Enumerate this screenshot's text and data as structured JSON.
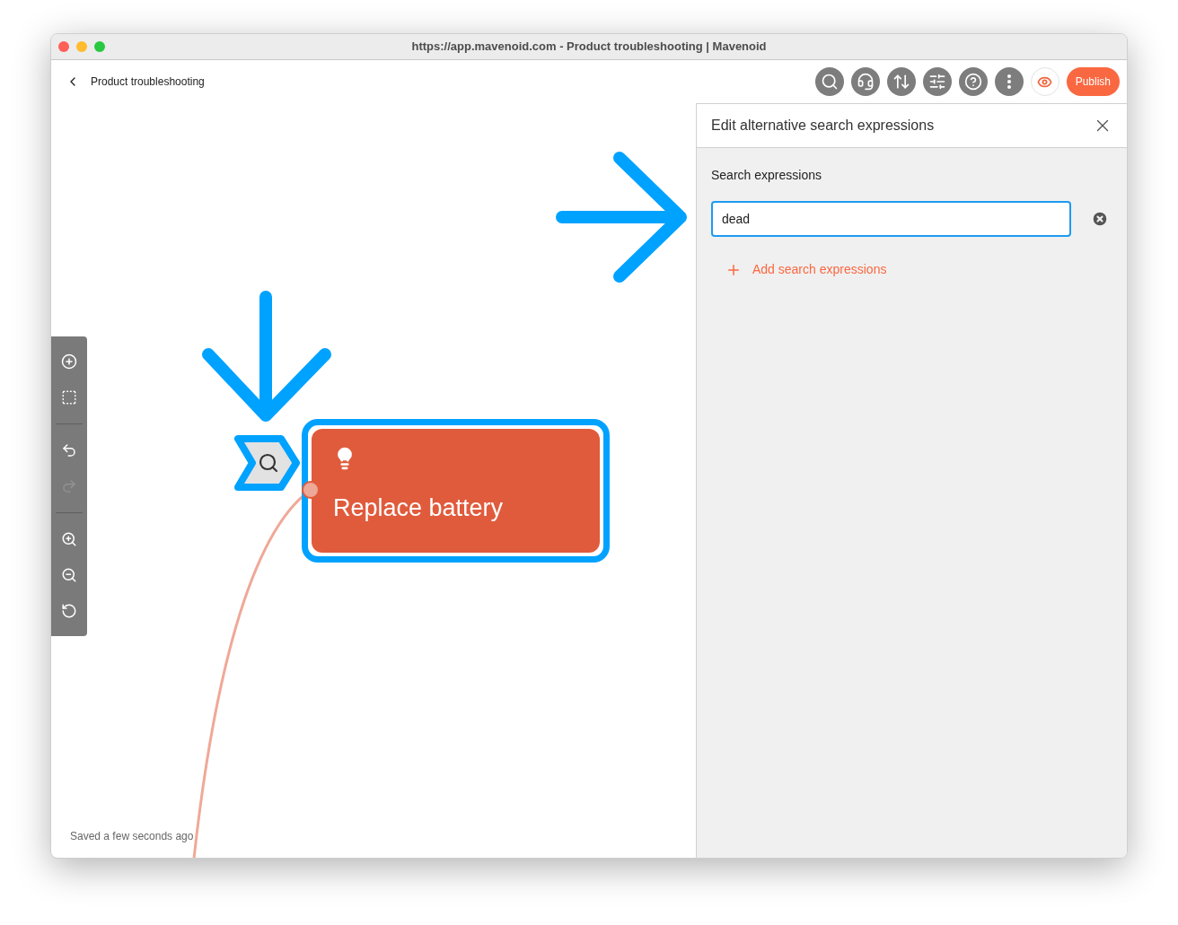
{
  "window": {
    "title": "https://app.mavenoid.com - Product troubleshooting | Mavenoid"
  },
  "header": {
    "title": "Product troubleshooting",
    "publish": "Publish"
  },
  "canvas_tools": [
    {
      "kind": "add",
      "disabled": false
    },
    {
      "kind": "select",
      "disabled": false
    },
    {
      "kind": "divider"
    },
    {
      "kind": "undo",
      "disabled": false
    },
    {
      "kind": "redo",
      "disabled": true
    },
    {
      "kind": "divider"
    },
    {
      "kind": "zoom-in",
      "disabled": false
    },
    {
      "kind": "zoom-out",
      "disabled": false
    },
    {
      "kind": "zoom-reset",
      "disabled": false
    }
  ],
  "search_tag": {
    "selected": true
  },
  "node": {
    "title": "Replace battery",
    "selected": true
  },
  "status": "Saved a few seconds ago",
  "panel": {
    "title": "Edit alternative search expressions",
    "section": "Search expressions",
    "expressions": [
      {
        "value": "dead",
        "focused": true
      }
    ],
    "add": "Add search expressions"
  }
}
